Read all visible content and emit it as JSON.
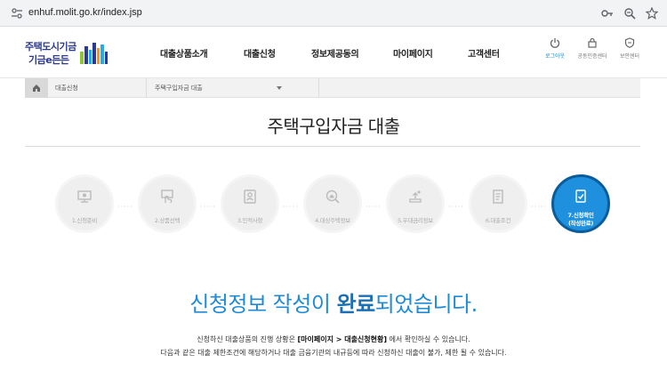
{
  "browser": {
    "url": "enhuf.molit.go.kr/index.jsp"
  },
  "header": {
    "logo_line1": "주택도시기금",
    "logo_line2": "기금e든든",
    "nav": [
      "대출상품소개",
      "대출신청",
      "정보제공동의",
      "마이페이지",
      "고객센터"
    ],
    "utilities": [
      {
        "label": "로그아웃",
        "icon": "power-icon"
      },
      {
        "label": "공동인증센터",
        "icon": "lock-icon"
      },
      {
        "label": "보안센터",
        "icon": "shield-icon"
      }
    ]
  },
  "breadcrumb": {
    "item1": "대출신청",
    "item2": "주택구입자금 대출"
  },
  "page": {
    "title": "주택구입자금 대출"
  },
  "steps": [
    {
      "label": "1.신청준비",
      "icon": "monitor-icon"
    },
    {
      "label": "2.상품선택",
      "icon": "hand-select-icon"
    },
    {
      "label": "3.인적사항",
      "icon": "id-card-icon"
    },
    {
      "label": "4.대상주택정보",
      "icon": "house-search-icon"
    },
    {
      "label": "5.우대금리정보",
      "icon": "rate-icon"
    },
    {
      "label": "6.대출조건",
      "icon": "document-icon"
    },
    {
      "label_line1": "7.신청확인",
      "label_line2": "(작성완료)",
      "icon": "check-doc-icon"
    }
  ],
  "message": {
    "pre": "신청정보 작성이 ",
    "emph": "완료",
    "post": "되었습니다.",
    "info1_pre": "신청하신 대출상품의 진행 상황은 ",
    "info1_bold": "[마이페이지 > 대출신청현황]",
    "info1_post": " 에서 확인하실 수 있습니다.",
    "info2": "다음과 같은 대출 제한조건에 해당하거나 대출 금융기관의 내규등에 따라 신청하신 대출이 불가, 제한 될 수 있습니다."
  },
  "colors": {
    "accent": "#1f90dd",
    "brand": "#2b3990"
  }
}
